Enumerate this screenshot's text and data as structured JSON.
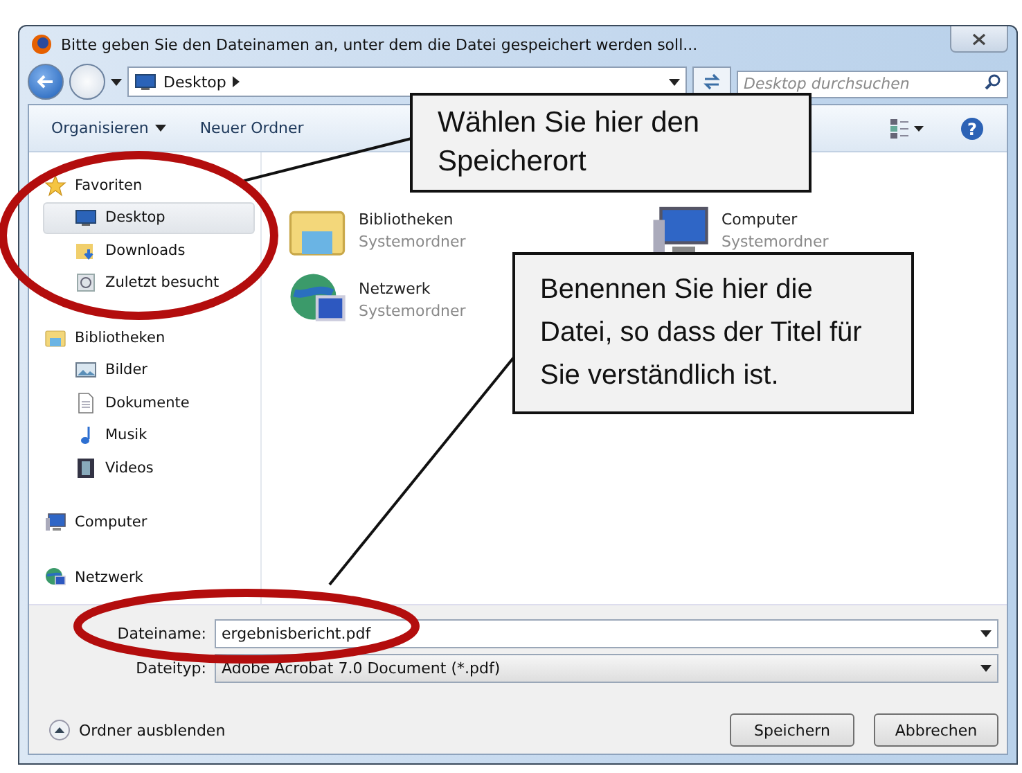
{
  "window": {
    "title": "Bitte geben Sie den Dateinamen an, unter dem die Datei gespeichert werden soll..."
  },
  "address": {
    "crumbs": [
      "Desktop"
    ]
  },
  "search": {
    "placeholder": "Desktop durchsuchen"
  },
  "toolbar": {
    "buttons": [
      {
        "label": "Organisieren",
        "dropdown": true
      },
      {
        "label": "Neuer Ordner",
        "dropdown": false
      }
    ],
    "help": "?"
  },
  "sidebar": {
    "groups": [
      {
        "label": "Favoriten",
        "kind": "star",
        "children": [
          {
            "label": "Desktop",
            "kind": "desktop",
            "selected": true
          },
          {
            "label": "Downloads",
            "kind": "download",
            "selected": false
          },
          {
            "label": "Zuletzt besucht",
            "kind": "recent",
            "selected": false
          }
        ]
      },
      {
        "label": "Bibliotheken",
        "kind": "library",
        "children": [
          {
            "label": "Bilder",
            "kind": "picture",
            "selected": false
          },
          {
            "label": "Dokumente",
            "kind": "document",
            "selected": false
          },
          {
            "label": "Musik",
            "kind": "music",
            "selected": false
          },
          {
            "label": "Videos",
            "kind": "video",
            "selected": false
          }
        ]
      },
      {
        "label": "Computer",
        "kind": "computer"
      },
      {
        "label": "Netzwerk",
        "kind": "network"
      }
    ]
  },
  "items": [
    {
      "name": "Bibliotheken",
      "type": "Systemordner",
      "kind": "library"
    },
    {
      "name": "Computer",
      "type": "Systemordner",
      "kind": "computer"
    },
    {
      "name": "Netzwerk",
      "type": "Systemordner",
      "kind": "network"
    }
  ],
  "filename": {
    "label": "Dateiname:",
    "value": "ergebnisbericht.pdf"
  },
  "filetype": {
    "label": "Dateityp:",
    "value": "Adobe Acrobat 7.0 Document (*.pdf)"
  },
  "hide_folders": "Ordner ausblenden",
  "buttons": [
    "Speichern",
    "Abbrechen"
  ],
  "callouts": [
    {
      "text": "Wählen Sie hier den Speicherort"
    },
    {
      "text": "Benennen Sie hier die Datei, so dass der Titel für Sie verständlich ist."
    }
  ]
}
